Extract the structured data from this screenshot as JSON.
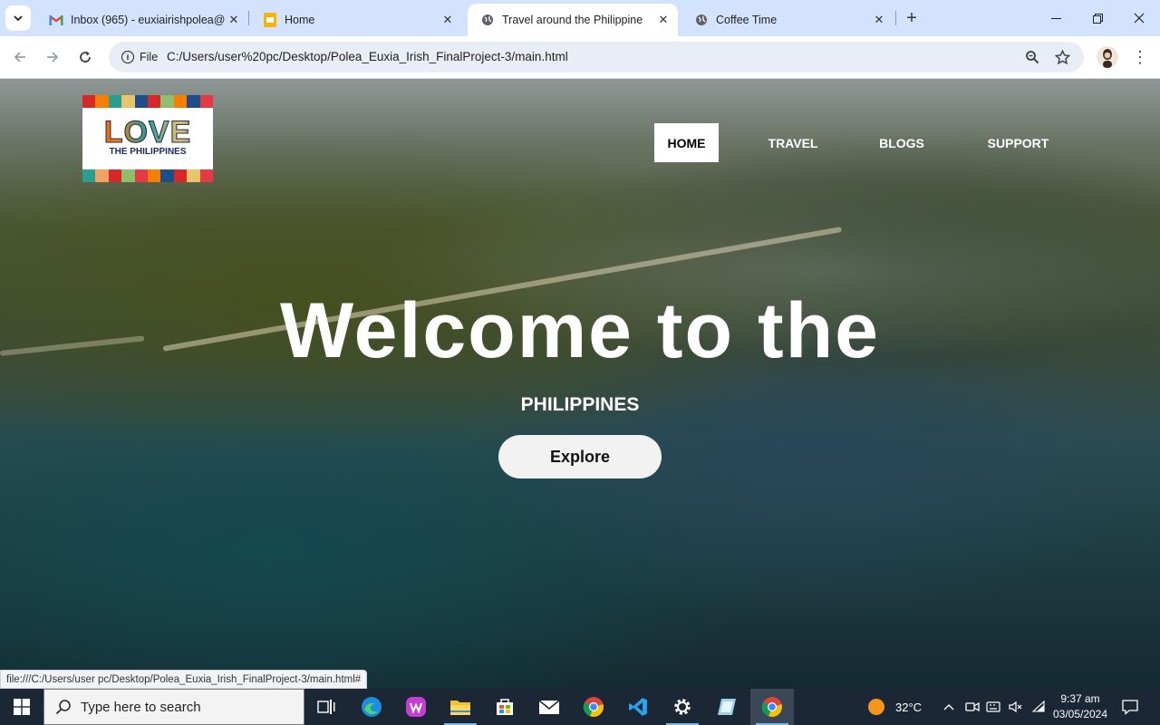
{
  "browser": {
    "tabs": [
      {
        "title": "Inbox (965) - euxiairishpolea@g",
        "icon": "gmail-icon"
      },
      {
        "title": "Home",
        "icon": "slides-icon"
      },
      {
        "title": "Travel around the Philippine",
        "icon": "globe-icon",
        "active": true
      },
      {
        "title": "Coffee Time",
        "icon": "globe-icon"
      }
    ],
    "site_info_label": "File",
    "url": "C:/Users/user%20pc/Desktop/Polea_Euxia_Irish_FinalProject-3/main.html",
    "status_url": "file:///C:/Users/user pc/Desktop/Polea_Euxia_Irish_FinalProject-3/main.html#"
  },
  "page": {
    "logo": {
      "line1": "LOVE",
      "line2": "THE PHILIPPINES"
    },
    "nav": [
      {
        "label": "HOME",
        "active": true
      },
      {
        "label": "TRAVEL"
      },
      {
        "label": "BLOGS"
      },
      {
        "label": "SUPPORT"
      }
    ],
    "hero_title": "Welcome to the",
    "hero_subtitle": "PHILIPPINES",
    "cta_label": "Explore"
  },
  "taskbar": {
    "search_placeholder": "Type here to search",
    "weather_temp": "32°C",
    "time": "9:37 am",
    "date": "03/05/2024"
  }
}
